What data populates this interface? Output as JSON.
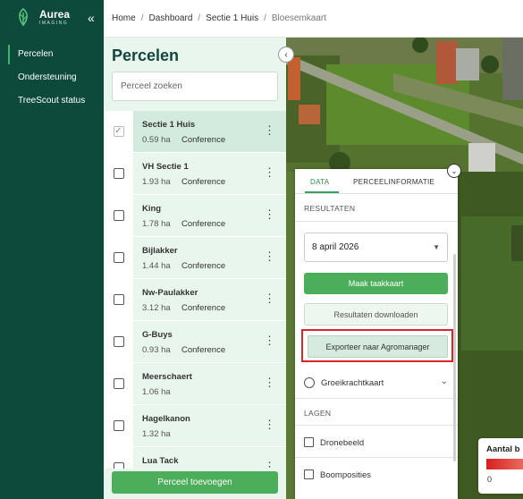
{
  "brand": {
    "name": "Aurea",
    "subtitle": "IMAGING"
  },
  "sidebar": {
    "collapse_label": "«",
    "items": [
      {
        "label": "Percelen",
        "active": true
      },
      {
        "label": "Ondersteuning",
        "active": false
      },
      {
        "label": "TreeScout status",
        "active": false
      }
    ]
  },
  "breadcrumb": {
    "separator": "/",
    "items": [
      "Home",
      "Dashboard",
      "Sectie 1 Huis"
    ],
    "current": "Bloesemkaart"
  },
  "percelen": {
    "title": "Percelen",
    "search_placeholder": "Perceel zoeken",
    "rows": [
      {
        "name": "Sectie 1 Huis",
        "ha": "0.59 ha",
        "variety": "Conference",
        "checked": true
      },
      {
        "name": "VH Sectie 1",
        "ha": "1.93 ha",
        "variety": "Conference",
        "checked": false
      },
      {
        "name": "King",
        "ha": "1.78 ha",
        "variety": "Conference",
        "checked": false
      },
      {
        "name": "Bijlakker",
        "ha": "1.44 ha",
        "variety": "Conference",
        "checked": false
      },
      {
        "name": "Nw-Paulakker",
        "ha": "3.12 ha",
        "variety": "Conference",
        "checked": false
      },
      {
        "name": "G-Buys",
        "ha": "0.93 ha",
        "variety": "Conference",
        "checked": false
      },
      {
        "name": "Meerschaert",
        "ha": "1.06 ha",
        "variety": "",
        "checked": false
      },
      {
        "name": "Hagelkanon",
        "ha": "1.32 ha",
        "variety": "",
        "checked": false
      },
      {
        "name": "Lua Tack",
        "ha": "",
        "variety": "",
        "checked": false
      }
    ],
    "add_button": "Perceel toevoegen",
    "collapse_icon": "‹"
  },
  "data_panel": {
    "tabs": [
      "DATA",
      "PERCEELINFORMATIE"
    ],
    "results_label": "RESULTATEN",
    "date_value": "8 april 2026",
    "task_map_button": "Maak taakkaart",
    "download_button": "Resultaten downloaden",
    "export_button": "Exporteer naar Agromanager",
    "growth_option": "Groeikrachtkaart",
    "layers_label": "LAGEN",
    "layers": [
      "Dronebeeld",
      "Boomposities"
    ],
    "toggle_icon": "⌄"
  },
  "legend": {
    "title": "Aantal b",
    "min_label": "0"
  },
  "colors": {
    "sidebar_bg": "#0e4a3c",
    "panel_bg": "#e8f6ee",
    "accent_green": "#4cae5a",
    "highlight_red": "#d62828"
  }
}
